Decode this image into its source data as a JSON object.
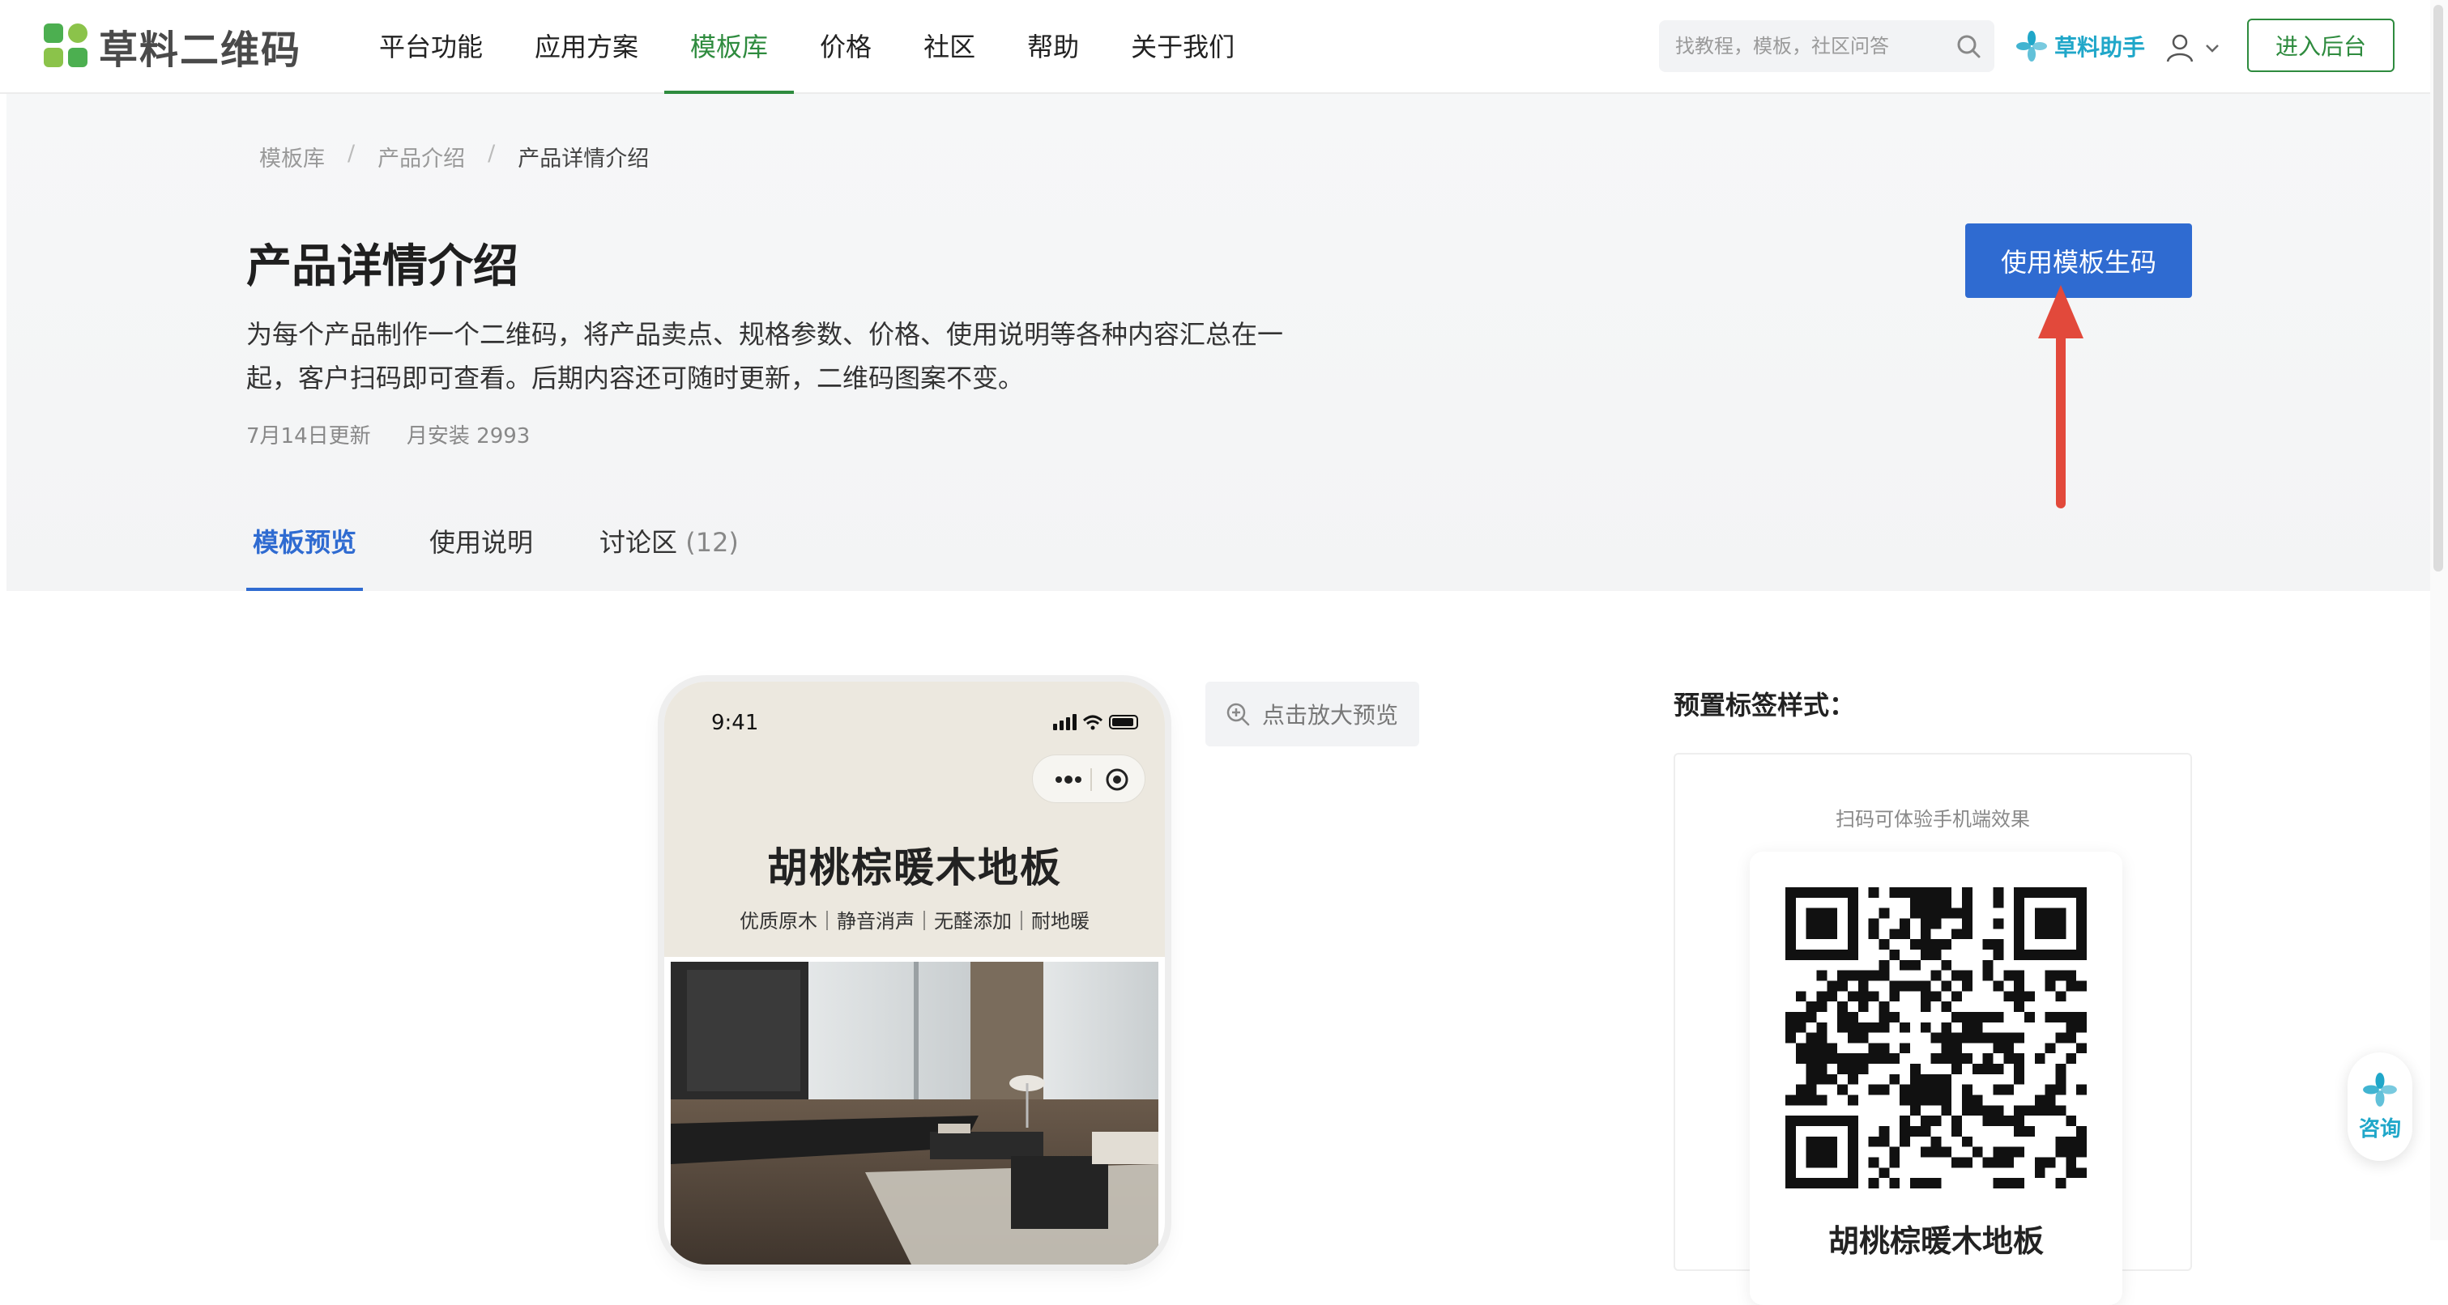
{
  "brand": {
    "name": "草料二维码",
    "green": "#2e8b3e",
    "blue": "#2f6bd1"
  },
  "nav": {
    "items": [
      {
        "label": "平台功能",
        "active": false
      },
      {
        "label": "应用方案",
        "active": false
      },
      {
        "label": "模板库",
        "active": true
      },
      {
        "label": "价格",
        "active": false
      },
      {
        "label": "社区",
        "active": false
      },
      {
        "label": "帮助",
        "active": false
      },
      {
        "label": "关于我们",
        "active": false
      }
    ],
    "search_placeholder": "找教程，模板，社区问答",
    "helper_label": "草料助手",
    "enter_label": "进入后台"
  },
  "breadcrumb": [
    "模板库",
    "产品介绍",
    "产品详情介绍"
  ],
  "header": {
    "title": "产品详情介绍",
    "description": "为每个产品制作一个二维码，将产品卖点、规格参数、价格、使用说明等各种内容汇总在一起，客户扫码即可查看。后期内容还可随时更新，二维码图案不变。",
    "updated": "7月14日更新",
    "installs": "月安装 2993",
    "use_button": "使用模板生码"
  },
  "tabs": [
    {
      "label": "模板预览",
      "count": "",
      "active": true
    },
    {
      "label": "使用说明",
      "count": "",
      "active": false
    },
    {
      "label": "讨论区",
      "count": "(12)",
      "active": false
    }
  ],
  "preview": {
    "status_time": "9:41",
    "product_title": "胡桃棕暖木地板",
    "product_subtitle": "优质原木｜静音消声｜无醛添加｜耐地暖",
    "zoom_label": "点击放大预览"
  },
  "preset": {
    "title": "预置标签样式：",
    "hint": "扫码可体验手机端效果",
    "qr_caption": "胡桃棕暖木地板"
  },
  "consult_label": "咨询"
}
